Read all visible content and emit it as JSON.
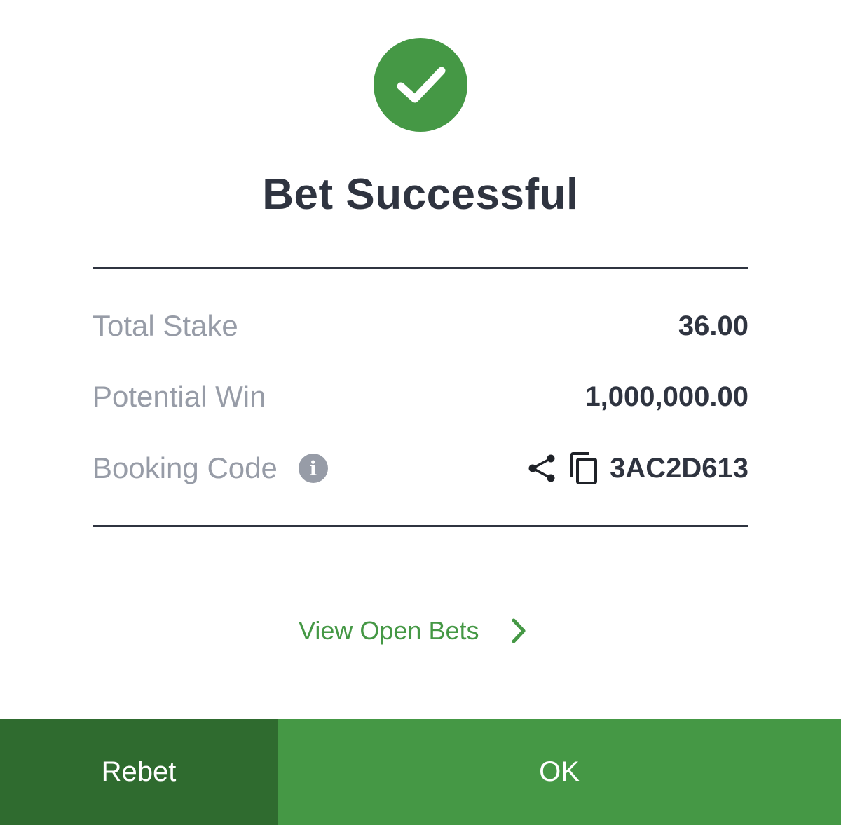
{
  "icons": {
    "success": "checkmark-circle-icon",
    "info": "info-icon",
    "share": "share-icon",
    "copy": "copy-icon",
    "chevron": "chevron-right-icon"
  },
  "colors": {
    "primary_green": "#459845",
    "dark_green": "#2f6b2f",
    "text_dark": "#2f3440",
    "text_muted": "#979ca7"
  },
  "title": "Bet Successful",
  "summary": {
    "total_stake_label": "Total Stake",
    "total_stake_value": "36.00",
    "potential_win_label": "Potential Win",
    "potential_win_value": "1,000,000.00",
    "booking_code_label": "Booking Code",
    "booking_code_value": "3AC2D613",
    "info_glyph": "i"
  },
  "links": {
    "view_open_bets": "View Open Bets"
  },
  "buttons": {
    "rebet": "Rebet",
    "ok": "OK"
  }
}
